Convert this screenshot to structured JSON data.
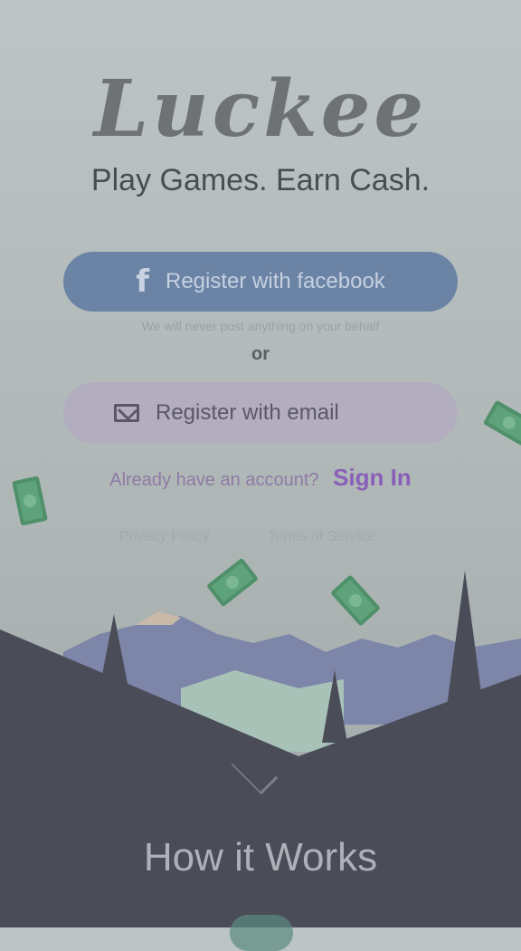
{
  "app": {
    "logo_text": "Luckee",
    "tagline": "Play Games.  Earn Cash."
  },
  "auth": {
    "facebook_button_label": "Register with facebook",
    "facebook_note": "We will never post anything on your behalf",
    "or_label": "or",
    "email_button_label": "Register with email",
    "already_account_text": "Already have an account?",
    "sign_in_label": "Sign In"
  },
  "legal": {
    "privacy_label": "Privacy Policy",
    "terms_label": "Terms of Service"
  },
  "footer": {
    "how_it_works_label": "How it Works"
  },
  "icons": {
    "facebook": "facebook-icon",
    "email": "email-icon",
    "chevron": "chevron-down-icon",
    "money": "money-bill-icon"
  },
  "colors": {
    "facebook_button": "#6b84a6",
    "email_button": "#b3aebf",
    "sign_in_link": "#8a5fb8",
    "background": "#b4bcbc",
    "mountains_dark": "#4a4c58"
  }
}
